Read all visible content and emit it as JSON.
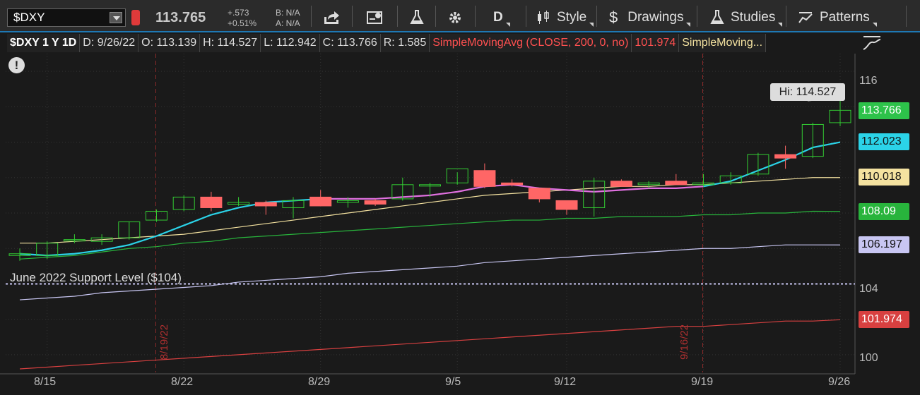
{
  "toolbar": {
    "symbol": "$DXY",
    "last_price": "113.765",
    "net_change": "+.573",
    "net_change_pct": "+0.51%",
    "bid": "B: N/A",
    "ask": "A: N/A",
    "timeframe": "D",
    "style_label": "Style",
    "drawings_label": "Drawings",
    "studies_label": "Studies",
    "patterns_label": "Patterns"
  },
  "infobar": {
    "symbol_period": "$DXY 1 Y 1D",
    "date": "D: 9/26/22",
    "open": "O: 113.139",
    "high": "H: 114.527",
    "low": "L: 112.942",
    "close": "C: 113.766",
    "range": "R: 1.585",
    "sma1": "SimpleMovingAvg (CLOSE, 200, 0, no)",
    "sma1_value": "101.974",
    "sma2": "SimpleMoving..."
  },
  "chart": {
    "y_axis_ticks": [
      "116",
      "104",
      "100"
    ],
    "price_labels": [
      {
        "value": "113.766",
        "color": "#2dc24a",
        "text": "#ffffff"
      },
      {
        "value": "112.023",
        "color": "#2bd3e8",
        "text": "#111111"
      },
      {
        "value": "110.018",
        "color": "#f4e2a0",
        "text": "#111111"
      },
      {
        "value": "108.09",
        "color": "#28b43c",
        "text": "#ffffff"
      },
      {
        "value": "106.197",
        "color": "#c8c6f2",
        "text": "#111111"
      },
      {
        "value": "101.974",
        "color": "#d84040",
        "text": "#ffffff"
      }
    ],
    "x_axis_labels": [
      "8/15",
      "8/22",
      "8/29",
      "9/5",
      "9/12",
      "9/19",
      "9/26"
    ],
    "vertical_dates": [
      "8/19/22",
      "9/16/22"
    ],
    "hi_callout": "Hi: 114.527",
    "support_label": "June 2022 Support Level ($104)",
    "support_level": 104,
    "colors": {
      "up": "#33cc33",
      "down": "#ff6666",
      "sma_fast": "#2bd3e8",
      "sma_fast_alt": "#e070e0",
      "sma_mid": "#f4e2a0",
      "sma_slow": "#28b43c",
      "sma_long": "#c8c6f2",
      "sma_200": "#d84040"
    }
  },
  "chart_data": {
    "type": "candlestick",
    "dates": [
      "8/12",
      "8/15",
      "8/16",
      "8/17",
      "8/18",
      "8/19",
      "8/22",
      "8/23",
      "8/24",
      "8/25",
      "8/26",
      "8/29",
      "8/30",
      "8/31",
      "9/1",
      "9/2",
      "9/6",
      "9/7",
      "9/8",
      "9/9",
      "9/12",
      "9/13",
      "9/14",
      "9/15",
      "9/16",
      "9/19",
      "9/20",
      "9/21",
      "9/22",
      "9/23",
      "9/26"
    ],
    "candles": [
      [
        105.6,
        106.0,
        105.3,
        105.7
      ],
      [
        105.6,
        106.4,
        105.4,
        106.3
      ],
      [
        106.5,
        106.8,
        106.3,
        106.5
      ],
      [
        106.4,
        106.8,
        106.2,
        106.6
      ],
      [
        106.6,
        107.5,
        106.5,
        107.5
      ],
      [
        107.6,
        108.2,
        107.5,
        108.1
      ],
      [
        108.2,
        109.0,
        108.1,
        108.9
      ],
      [
        108.9,
        109.2,
        108.1,
        108.3
      ],
      [
        108.5,
        108.9,
        108.4,
        108.6
      ],
      [
        108.6,
        108.7,
        107.9,
        108.4
      ],
      [
        108.3,
        108.9,
        107.7,
        108.7
      ],
      [
        108.9,
        109.3,
        108.4,
        108.4
      ],
      [
        108.6,
        108.9,
        108.3,
        108.7
      ],
      [
        108.7,
        108.8,
        108.4,
        108.5
      ],
      [
        108.8,
        110.0,
        108.7,
        109.6
      ],
      [
        109.6,
        109.7,
        108.9,
        109.6
      ],
      [
        109.7,
        110.3,
        109.6,
        110.5
      ],
      [
        110.4,
        110.8,
        109.4,
        109.5
      ],
      [
        109.7,
        109.9,
        109.5,
        109.6
      ],
      [
        109.4,
        109.4,
        108.6,
        108.8
      ],
      [
        108.7,
        108.7,
        107.9,
        108.2
      ],
      [
        108.3,
        110.0,
        107.8,
        109.8
      ],
      [
        109.8,
        109.9,
        109.5,
        109.5
      ],
      [
        109.6,
        109.8,
        109.4,
        109.7
      ],
      [
        109.8,
        110.2,
        109.6,
        109.6
      ],
      [
        109.6,
        110.2,
        109.5,
        109.7
      ],
      [
        109.7,
        110.3,
        109.6,
        110.1
      ],
      [
        110.2,
        111.4,
        110.1,
        111.3
      ],
      [
        111.3,
        111.8,
        110.5,
        111.1
      ],
      [
        111.2,
        113.1,
        111.1,
        113.0
      ],
      [
        113.1,
        114.5,
        112.9,
        113.8
      ]
    ],
    "sma_fast": [
      105.7,
      105.6,
      105.7,
      105.9,
      106.2,
      106.7,
      107.3,
      107.9,
      108.3,
      108.6,
      108.7,
      108.8,
      108.8,
      108.8,
      108.9,
      109.0,
      109.2,
      109.5,
      109.6,
      109.4,
      109.3,
      109.2,
      109.3,
      109.4,
      109.4,
      109.5,
      109.8,
      110.4,
      111.0,
      111.7,
      112.0
    ],
    "sma_mid": [
      106.3,
      106.3,
      106.4,
      106.5,
      106.6,
      106.7,
      106.8,
      107.0,
      107.2,
      107.4,
      107.6,
      107.8,
      108.0,
      108.2,
      108.4,
      108.6,
      108.8,
      109.0,
      109.1,
      109.2,
      109.3,
      109.4,
      109.5,
      109.5,
      109.6,
      109.6,
      109.7,
      109.8,
      109.9,
      110.0,
      110.0
    ],
    "sma_slow": [
      105.4,
      105.5,
      105.6,
      105.8,
      106.0,
      106.1,
      106.3,
      106.4,
      106.6,
      106.7,
      106.8,
      106.9,
      107.0,
      107.1,
      107.2,
      107.3,
      107.4,
      107.5,
      107.6,
      107.6,
      107.7,
      107.7,
      107.8,
      107.8,
      107.8,
      107.9,
      107.9,
      108.0,
      108.0,
      108.1,
      108.09
    ],
    "sma_long": [
      103.1,
      103.2,
      103.3,
      103.5,
      103.6,
      103.7,
      103.8,
      103.9,
      104.1,
      104.2,
      104.3,
      104.4,
      104.6,
      104.7,
      104.8,
      104.9,
      105.0,
      105.2,
      105.3,
      105.4,
      105.5,
      105.6,
      105.7,
      105.8,
      105.9,
      106.0,
      106.0,
      106.1,
      106.2,
      106.2,
      106.197
    ],
    "sma_200": [
      99.2,
      99.3,
      99.4,
      99.5,
      99.6,
      99.7,
      99.8,
      99.9,
      100.0,
      100.1,
      100.2,
      100.3,
      100.4,
      100.5,
      100.6,
      100.7,
      100.8,
      100.9,
      101.0,
      101.1,
      101.2,
      101.3,
      101.4,
      101.5,
      101.6,
      101.6,
      101.7,
      101.8,
      101.9,
      101.9,
      101.974
    ],
    "ylim": [
      99,
      117
    ],
    "support_level": 104
  }
}
